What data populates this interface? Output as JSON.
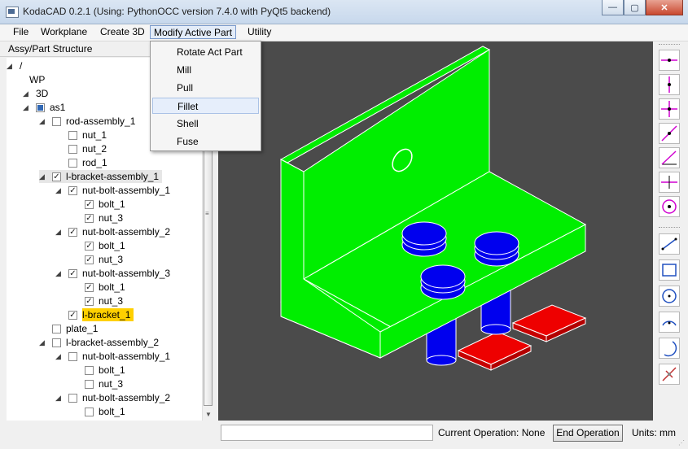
{
  "window": {
    "title": "KodaCAD 0.2.1 (Using: PythonOCC version 7.4.0 with PyQt5 backend)",
    "minimize_glyph": "—",
    "maximize_glyph": "▢",
    "close_glyph": "✕"
  },
  "menubar": {
    "items": [
      "File",
      "Workplane",
      "Create 3D",
      "Modify Active Part",
      "Utility"
    ],
    "active": "Modify Active Part"
  },
  "modify_menu": {
    "items": [
      "Rotate Act Part",
      "Mill",
      "Pull",
      "Fillet",
      "Shell",
      "Fuse"
    ],
    "hovered": "Fillet"
  },
  "tree": {
    "header": "Assy/Part Structure",
    "rows": [
      {
        "label": "/",
        "arrow": "open",
        "check": "none",
        "level": 0
      },
      {
        "label": "WP",
        "arrow": "none",
        "check": "none",
        "level": 1
      },
      {
        "label": "3D",
        "arrow": "open",
        "check": "none",
        "level": 1
      },
      {
        "label": "as1",
        "arrow": "open",
        "check": "partial",
        "level": 2
      },
      {
        "label": "rod-assembly_1",
        "arrow": "open",
        "check": "unchecked",
        "level": 3
      },
      {
        "label": "nut_1",
        "arrow": "none",
        "check": "unchecked",
        "level": 4
      },
      {
        "label": "nut_2",
        "arrow": "none",
        "check": "unchecked",
        "level": 4
      },
      {
        "label": "rod_1",
        "arrow": "none",
        "check": "unchecked",
        "level": 4
      },
      {
        "label": "l-bracket-assembly_1",
        "arrow": "open",
        "check": "checked",
        "level": 3,
        "selected": true
      },
      {
        "label": "nut-bolt-assembly_1",
        "arrow": "open",
        "check": "checked",
        "level": 4
      },
      {
        "label": "bolt_1",
        "arrow": "none",
        "check": "checked",
        "level": 5
      },
      {
        "label": "nut_3",
        "arrow": "none",
        "check": "checked",
        "level": 5
      },
      {
        "label": "nut-bolt-assembly_2",
        "arrow": "open",
        "check": "checked",
        "level": 4
      },
      {
        "label": "bolt_1",
        "arrow": "none",
        "check": "checked",
        "level": 5
      },
      {
        "label": "nut_3",
        "arrow": "none",
        "check": "checked",
        "level": 5
      },
      {
        "label": "nut-bolt-assembly_3",
        "arrow": "open",
        "check": "checked",
        "level": 4
      },
      {
        "label": "bolt_1",
        "arrow": "none",
        "check": "checked",
        "level": 5
      },
      {
        "label": "nut_3",
        "arrow": "none",
        "check": "checked",
        "level": 5
      },
      {
        "label": "l-bracket_1",
        "arrow": "none",
        "check": "checked",
        "level": 4,
        "active": true
      },
      {
        "label": "plate_1",
        "arrow": "none",
        "check": "unchecked",
        "level": 3
      },
      {
        "label": "l-bracket-assembly_2",
        "arrow": "open",
        "check": "unchecked",
        "level": 3
      },
      {
        "label": "nut-bolt-assembly_1",
        "arrow": "open",
        "check": "unchecked",
        "level": 4
      },
      {
        "label": "bolt_1",
        "arrow": "none",
        "check": "unchecked",
        "level": 5
      },
      {
        "label": "nut_3",
        "arrow": "none",
        "check": "unchecked",
        "level": 5
      },
      {
        "label": "nut-bolt-assembly_2",
        "arrow": "open",
        "check": "unchecked",
        "level": 4
      },
      {
        "label": "bolt_1",
        "arrow": "none",
        "check": "unchecked",
        "level": 5
      }
    ]
  },
  "status": {
    "input_value": "",
    "current_operation": "Current Operation: None",
    "end_button": "End Operation",
    "units": "Units: mm"
  },
  "toolbar": {
    "icons": [
      "horizontal-line-icon",
      "vertical-line-icon",
      "cross-lines-icon",
      "diagonal-line-icon",
      "angled-line-icon",
      "perpendicular-line-icon",
      "circle-center-icon",
      "line-segment-icon",
      "rectangle-icon",
      "circle-icon",
      "arc-three-point-icon",
      "arc-curve-icon",
      "delete-element-icon"
    ]
  },
  "colors": {
    "part_active": "#00ee00",
    "bolt": "#0000ee",
    "plate": "#ee0000",
    "viewport_bg": "#4b4b4b",
    "tree_highlight": "#ffd000"
  }
}
